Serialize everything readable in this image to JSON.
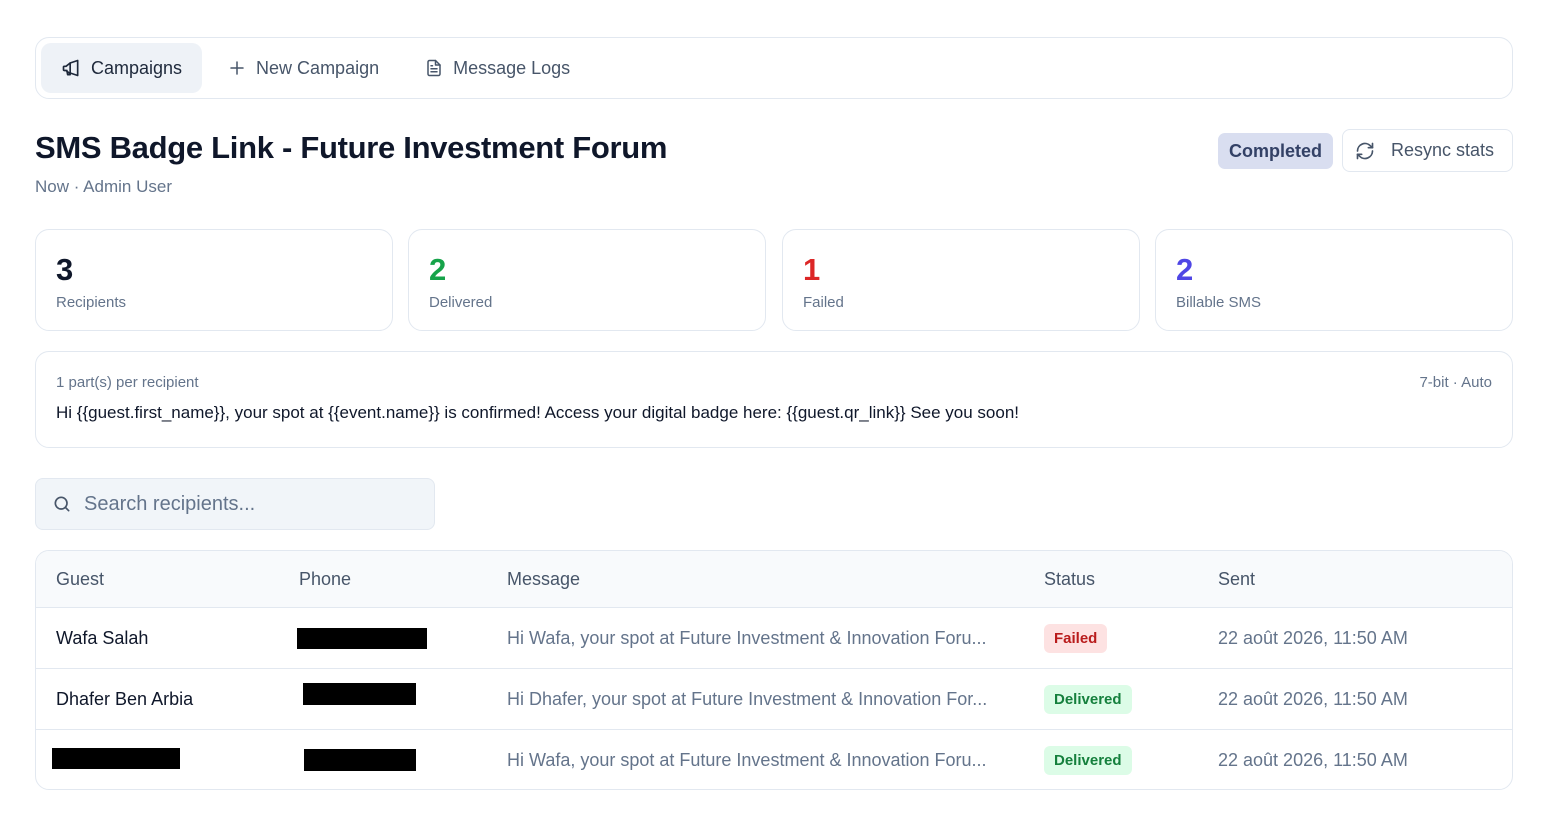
{
  "nav": {
    "tabs": [
      {
        "label": "Campaigns",
        "icon": "megaphone-icon",
        "active": true
      },
      {
        "label": "New Campaign",
        "icon": "plus-icon",
        "active": false
      },
      {
        "label": "Message Logs",
        "icon": "document-icon",
        "active": false
      }
    ]
  },
  "campaign": {
    "title": "SMS Badge Link - Future Investment Forum",
    "subtitle": "Now · Admin User",
    "status": "Completed",
    "resync_label": "Resync stats"
  },
  "stats": [
    {
      "value": "3",
      "label": "Recipients",
      "color": "#0f172a"
    },
    {
      "value": "2",
      "label": "Delivered",
      "color": "#16a34a"
    },
    {
      "value": "1",
      "label": "Failed",
      "color": "#dc2626"
    },
    {
      "value": "2",
      "label": "Billable SMS",
      "color": "#4f46e5"
    }
  ],
  "message": {
    "parts": "1 part(s) per recipient",
    "encoding": "7-bit · Auto",
    "body": "Hi {{guest.first_name}}, your spot at {{event.name}} is confirmed! Access your digital badge here: {{guest.qr_link}} See you soon!"
  },
  "search": {
    "placeholder": "Search recipients..."
  },
  "table": {
    "columns": [
      "Guest",
      "Phone",
      "Message",
      "Status",
      "Sent"
    ],
    "rows": [
      {
        "guest": "Wafa Salah",
        "message": "Hi Wafa, your spot at Future Investment & Innovation Foru...",
        "status": "Failed",
        "sent": "22 août 2026, 11:50 AM"
      },
      {
        "guest": "Dhafer Ben Arbia",
        "message": "Hi Dhafer, your spot at Future Investment & Innovation For...",
        "status": "Delivered",
        "sent": "22 août 2026, 11:50 AM"
      },
      {
        "guest": "",
        "message": "Hi Wafa, your spot at Future Investment & Innovation Foru...",
        "status": "Delivered",
        "sent": "22 août 2026, 11:50 AM"
      }
    ]
  }
}
